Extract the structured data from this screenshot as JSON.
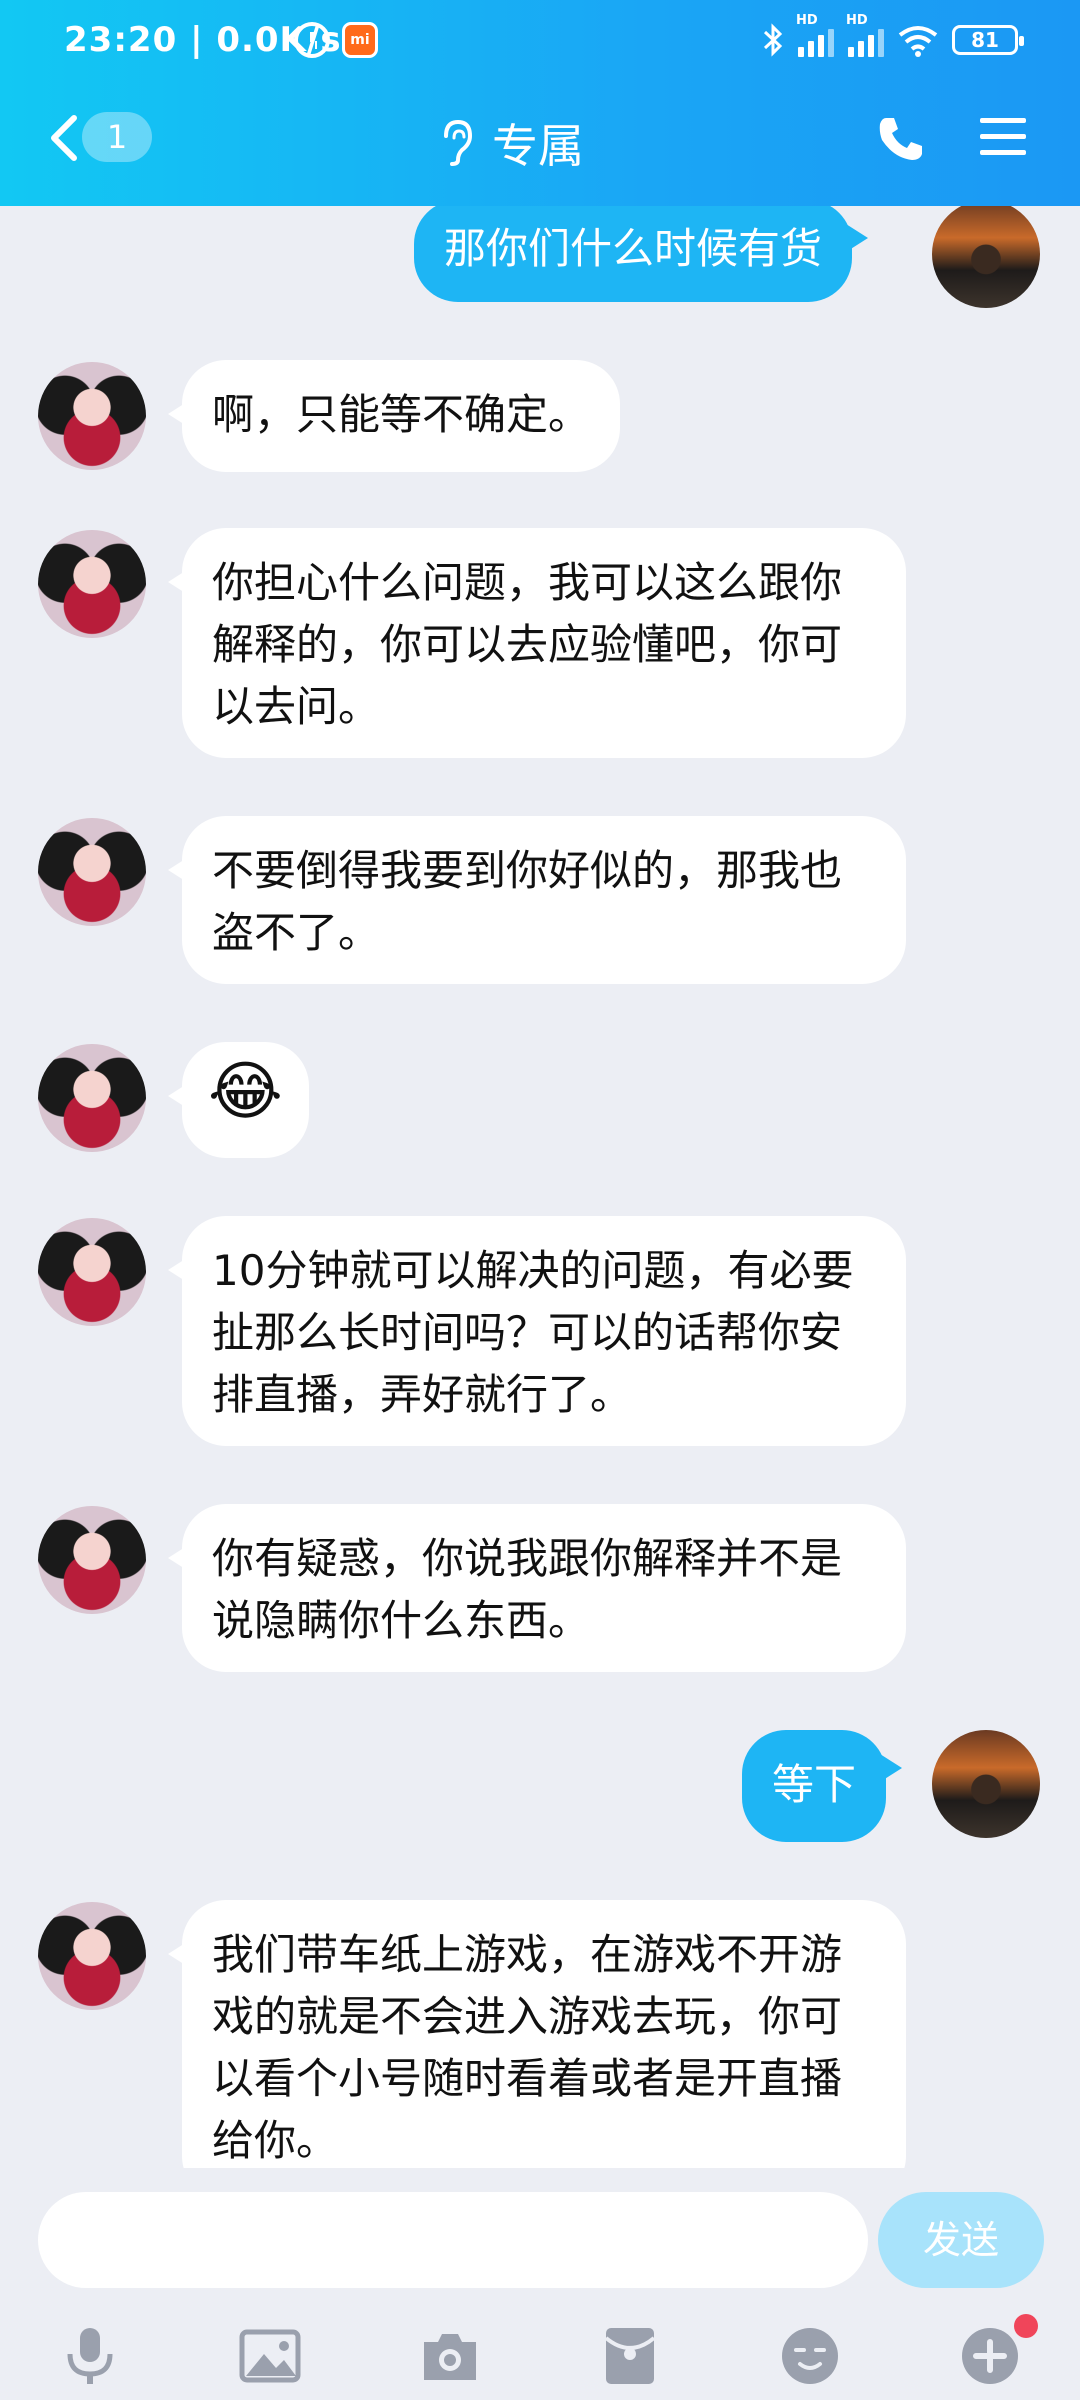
{
  "status_bar": {
    "time": "23:20 | 0.0K/s",
    "battery": "81",
    "hd1": "HD",
    "hd2": "HD"
  },
  "header": {
    "unread_count": "1",
    "title": "专属"
  },
  "messages": [
    {
      "side": "right",
      "text": "那你们什么时候有货"
    },
    {
      "side": "left",
      "text": "啊，只能等不确定。"
    },
    {
      "side": "left",
      "text": "你担心什么问题，我可以这么跟你解释的，你可以去应验懂吧，你可以去问。"
    },
    {
      "side": "left",
      "text": "不要倒得我要到你好似的，那我也盗不了。"
    },
    {
      "side": "left",
      "text": "😂",
      "kind": "emoji"
    },
    {
      "side": "left",
      "text": "10分钟就可以解决的问题，有必要扯那么长时间吗？可以的话帮你安排直播，弄好就行了。"
    },
    {
      "side": "left",
      "text": "你有疑惑，你说我跟你解释并不是说隐瞒你什么东西。"
    },
    {
      "side": "right",
      "text": "等下"
    },
    {
      "side": "left",
      "text": "我们带车纸上游戏，在游戏不开游戏的就是不会进入游戏去玩，你可以看个小号随时看着或者是开直播给你。"
    }
  ],
  "composer": {
    "input_value": "",
    "send_label": "发送"
  },
  "colors": {
    "header_start": "#12c8f3",
    "header_end": "#1b98f4",
    "my_bubble": "#1eb5f4",
    "background": "#eceef4",
    "badge": "#f0455a"
  }
}
